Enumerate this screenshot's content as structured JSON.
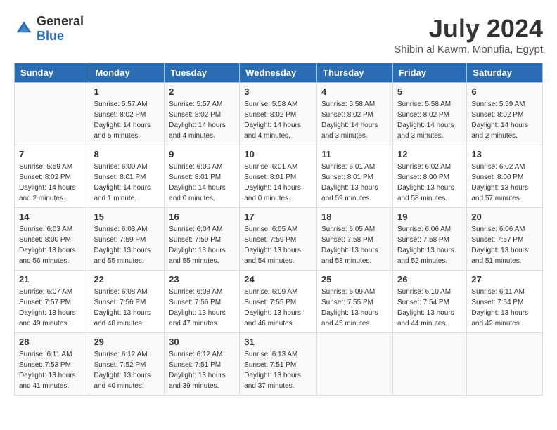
{
  "logo": {
    "general": "General",
    "blue": "Blue"
  },
  "header": {
    "month": "July 2024",
    "location": "Shibin al Kawm, Monufia, Egypt"
  },
  "weekdays": [
    "Sunday",
    "Monday",
    "Tuesday",
    "Wednesday",
    "Thursday",
    "Friday",
    "Saturday"
  ],
  "weeks": [
    [
      {
        "day": "",
        "info": ""
      },
      {
        "day": "1",
        "info": "Sunrise: 5:57 AM\nSunset: 8:02 PM\nDaylight: 14 hours\nand 5 minutes."
      },
      {
        "day": "2",
        "info": "Sunrise: 5:57 AM\nSunset: 8:02 PM\nDaylight: 14 hours\nand 4 minutes."
      },
      {
        "day": "3",
        "info": "Sunrise: 5:58 AM\nSunset: 8:02 PM\nDaylight: 14 hours\nand 4 minutes."
      },
      {
        "day": "4",
        "info": "Sunrise: 5:58 AM\nSunset: 8:02 PM\nDaylight: 14 hours\nand 3 minutes."
      },
      {
        "day": "5",
        "info": "Sunrise: 5:58 AM\nSunset: 8:02 PM\nDaylight: 14 hours\nand 3 minutes."
      },
      {
        "day": "6",
        "info": "Sunrise: 5:59 AM\nSunset: 8:02 PM\nDaylight: 14 hours\nand 2 minutes."
      }
    ],
    [
      {
        "day": "7",
        "info": "Sunrise: 5:59 AM\nSunset: 8:02 PM\nDaylight: 14 hours\nand 2 minutes."
      },
      {
        "day": "8",
        "info": "Sunrise: 6:00 AM\nSunset: 8:01 PM\nDaylight: 14 hours\nand 1 minute."
      },
      {
        "day": "9",
        "info": "Sunrise: 6:00 AM\nSunset: 8:01 PM\nDaylight: 14 hours\nand 0 minutes."
      },
      {
        "day": "10",
        "info": "Sunrise: 6:01 AM\nSunset: 8:01 PM\nDaylight: 14 hours\nand 0 minutes."
      },
      {
        "day": "11",
        "info": "Sunrise: 6:01 AM\nSunset: 8:01 PM\nDaylight: 13 hours\nand 59 minutes."
      },
      {
        "day": "12",
        "info": "Sunrise: 6:02 AM\nSunset: 8:00 PM\nDaylight: 13 hours\nand 58 minutes."
      },
      {
        "day": "13",
        "info": "Sunrise: 6:02 AM\nSunset: 8:00 PM\nDaylight: 13 hours\nand 57 minutes."
      }
    ],
    [
      {
        "day": "14",
        "info": "Sunrise: 6:03 AM\nSunset: 8:00 PM\nDaylight: 13 hours\nand 56 minutes."
      },
      {
        "day": "15",
        "info": "Sunrise: 6:03 AM\nSunset: 7:59 PM\nDaylight: 13 hours\nand 55 minutes."
      },
      {
        "day": "16",
        "info": "Sunrise: 6:04 AM\nSunset: 7:59 PM\nDaylight: 13 hours\nand 55 minutes."
      },
      {
        "day": "17",
        "info": "Sunrise: 6:05 AM\nSunset: 7:59 PM\nDaylight: 13 hours\nand 54 minutes."
      },
      {
        "day": "18",
        "info": "Sunrise: 6:05 AM\nSunset: 7:58 PM\nDaylight: 13 hours\nand 53 minutes."
      },
      {
        "day": "19",
        "info": "Sunrise: 6:06 AM\nSunset: 7:58 PM\nDaylight: 13 hours\nand 52 minutes."
      },
      {
        "day": "20",
        "info": "Sunrise: 6:06 AM\nSunset: 7:57 PM\nDaylight: 13 hours\nand 51 minutes."
      }
    ],
    [
      {
        "day": "21",
        "info": "Sunrise: 6:07 AM\nSunset: 7:57 PM\nDaylight: 13 hours\nand 49 minutes."
      },
      {
        "day": "22",
        "info": "Sunrise: 6:08 AM\nSunset: 7:56 PM\nDaylight: 13 hours\nand 48 minutes."
      },
      {
        "day": "23",
        "info": "Sunrise: 6:08 AM\nSunset: 7:56 PM\nDaylight: 13 hours\nand 47 minutes."
      },
      {
        "day": "24",
        "info": "Sunrise: 6:09 AM\nSunset: 7:55 PM\nDaylight: 13 hours\nand 46 minutes."
      },
      {
        "day": "25",
        "info": "Sunrise: 6:09 AM\nSunset: 7:55 PM\nDaylight: 13 hours\nand 45 minutes."
      },
      {
        "day": "26",
        "info": "Sunrise: 6:10 AM\nSunset: 7:54 PM\nDaylight: 13 hours\nand 44 minutes."
      },
      {
        "day": "27",
        "info": "Sunrise: 6:11 AM\nSunset: 7:54 PM\nDaylight: 13 hours\nand 42 minutes."
      }
    ],
    [
      {
        "day": "28",
        "info": "Sunrise: 6:11 AM\nSunset: 7:53 PM\nDaylight: 13 hours\nand 41 minutes."
      },
      {
        "day": "29",
        "info": "Sunrise: 6:12 AM\nSunset: 7:52 PM\nDaylight: 13 hours\nand 40 minutes."
      },
      {
        "day": "30",
        "info": "Sunrise: 6:12 AM\nSunset: 7:51 PM\nDaylight: 13 hours\nand 39 minutes."
      },
      {
        "day": "31",
        "info": "Sunrise: 6:13 AM\nSunset: 7:51 PM\nDaylight: 13 hours\nand 37 minutes."
      },
      {
        "day": "",
        "info": ""
      },
      {
        "day": "",
        "info": ""
      },
      {
        "day": "",
        "info": ""
      }
    ]
  ]
}
